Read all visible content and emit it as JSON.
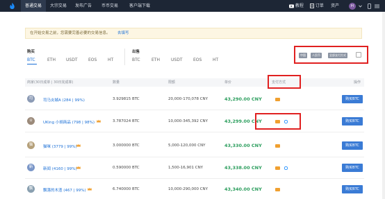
{
  "nav": {
    "items": [
      "普通交易",
      "大宗交易",
      "发布广告",
      "币币交易",
      "客户端下载"
    ],
    "active": 0,
    "right": {
      "tutorial": "教程",
      "orders": "订单",
      "assets": "资产",
      "avatar_letter": "H"
    }
  },
  "notice": {
    "text": "在开始交易之前，您需要完善必要的交易信息。",
    "link": "去填写"
  },
  "buy": {
    "label": "购买",
    "coins": [
      "BTC",
      "ETH",
      "USDT",
      "EOS",
      "HT"
    ]
  },
  "sell": {
    "label": "出售",
    "coins": [
      "BTC",
      "ETH",
      "USDT",
      "EOS",
      "HT"
    ]
  },
  "filters": {
    "country": "中国",
    "currency": "人民币",
    "payment": "全部支付方式"
  },
  "table": {
    "headers": [
      "商家(30日成单 | 30日完成率)",
      "数量",
      "限额",
      "单价",
      "支付方式",
      "操作"
    ],
    "rows": [
      {
        "avatar": "司",
        "avatar_color": "#8c9bb5",
        "name": "司马炎城A (284 | 99%)",
        "amount": "3.929815 BTC",
        "limit": "20,000-170,078 CNY",
        "price": "43,290.00 CNY",
        "action": "购买BTC",
        "crown": false
      },
      {
        "avatar": "U",
        "avatar_color": "#9b8a7a",
        "name": "UKing 小胡商品 (798 | 98%)",
        "amount": "3.787024 BTC",
        "limit": "10,000-345,392 CNY",
        "price": "43,299.00 CNY",
        "action": "购买BTC",
        "crown": true
      },
      {
        "avatar": "猫",
        "avatar_color": "#b5a07a",
        "name": "猫咪 (3779 | 99%)",
        "amount": "3.000000 BTC",
        "limit": "5,000-120,000 CNY",
        "price": "43,330.00 CNY",
        "action": "购买BTC",
        "crown": true
      },
      {
        "avatar": "新",
        "avatar_color": "#7a96c8",
        "name": "新闻 (4160 | 99%)",
        "amount": "0.590000 BTC",
        "limit": "1,500-16,901 CNY",
        "price": "43,338.00 CNY",
        "action": "购买BTC",
        "crown": true
      },
      {
        "avatar": "飘",
        "avatar_color": "#8aa0b0",
        "name": "飘落的木渣 (467 | 99%)",
        "amount": "6.740000 BTC",
        "limit": "10,000-290,000 CNY",
        "price": "43,340.00 CNY",
        "action": "购买BTC",
        "crown": true
      }
    ]
  },
  "colors": {
    "nav_bg": "#1d2635",
    "accent": "#1a6fd6",
    "price": "#2a9d5c",
    "button": "#3a7bd5",
    "highlight": "#e02020"
  }
}
